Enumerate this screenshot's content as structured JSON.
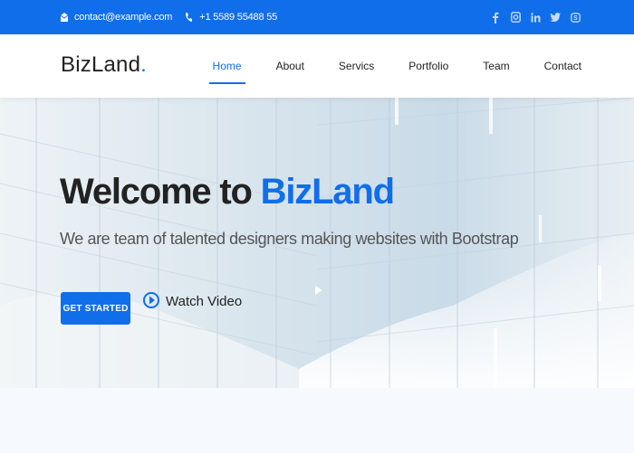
{
  "topbar": {
    "email": "contact@example.com",
    "phone": "+1 5589 55488 55",
    "icons": [
      "envelope-icon",
      "phone-icon"
    ],
    "social": [
      "facebook-icon",
      "instagram-icon",
      "linkedin-icon",
      "twitter-icon",
      "skype-icon"
    ]
  },
  "header": {
    "logo_text": "BizLand",
    "logo_dot": ".",
    "nav": [
      "Home",
      "About",
      "Servics",
      "Portfolio",
      "Team",
      "Contact"
    ],
    "active_nav": "Home"
  },
  "hero": {
    "title_prefix": "Welcome to ",
    "title_accent": "BizLand",
    "subtitle": "We are team of talented designers making websites with Bootstrap",
    "cta_label": "GET STARTED",
    "video_label": "Watch Video"
  },
  "colors": {
    "accent": "#106eea",
    "text": "#222222"
  }
}
